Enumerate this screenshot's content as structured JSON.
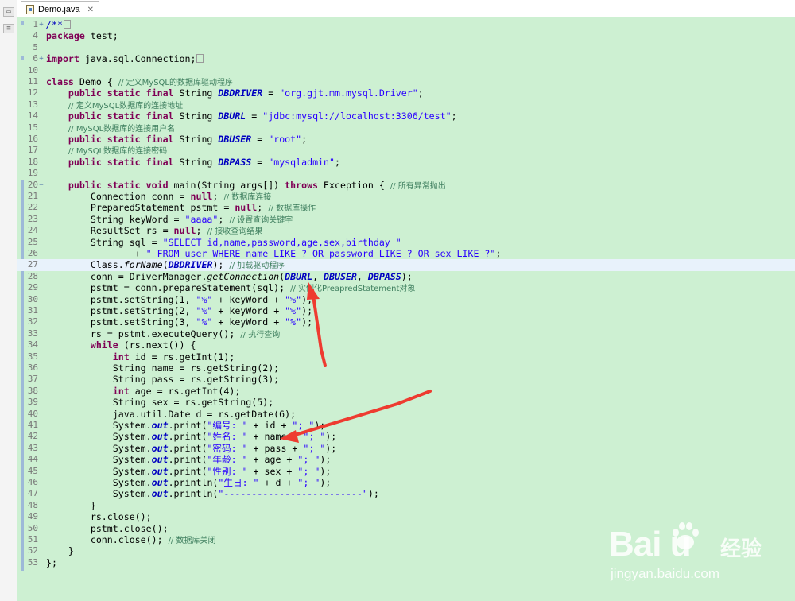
{
  "tab": {
    "title": "Demo.java",
    "close": "✕"
  },
  "watermark": {
    "brand": "Bai  u",
    "brand_cn": "经验",
    "url": "jingyan.baidu.com"
  },
  "code_lines": [
    {
      "n": "1",
      "fold": "+",
      "current": false,
      "tokens": [
        [
          "sfld",
          "/**"
        ],
        [
          "box",
          ""
        ]
      ]
    },
    {
      "n": "4",
      "tokens": [
        [
          "kw",
          "package"
        ],
        [
          "t",
          " test;"
        ]
      ]
    },
    {
      "n": "5",
      "tokens": []
    },
    {
      "n": "6",
      "fold": "+",
      "tokens": [
        [
          "kw",
          "import"
        ],
        [
          "t",
          " java.sql.Connection;"
        ],
        [
          "box",
          ""
        ]
      ]
    },
    {
      "n": "10",
      "tokens": []
    },
    {
      "n": "11",
      "tokens": [
        [
          "kw",
          "class"
        ],
        [
          "t",
          " Demo { "
        ],
        [
          "cm",
          "// 定义MySQL的数据库驱动程序"
        ]
      ]
    },
    {
      "n": "12",
      "tokens": [
        [
          "t",
          "    "
        ],
        [
          "kw",
          "public static final"
        ],
        [
          "t",
          " String "
        ],
        [
          "fld",
          "DBDRIVER"
        ],
        [
          "t",
          " = "
        ],
        [
          "str",
          "\"org.gjt.mm.mysql.Driver\""
        ],
        [
          "t",
          ";"
        ]
      ]
    },
    {
      "n": "13",
      "tokens": [
        [
          "t",
          "    "
        ],
        [
          "cm",
          "// 定义MySQL数据库的连接地址"
        ]
      ]
    },
    {
      "n": "14",
      "tokens": [
        [
          "t",
          "    "
        ],
        [
          "kw",
          "public static final"
        ],
        [
          "t",
          " String "
        ],
        [
          "fld",
          "DBURL"
        ],
        [
          "t",
          " = "
        ],
        [
          "str",
          "\"jdbc:mysql://localhost:3306/test\""
        ],
        [
          "t",
          ";"
        ]
      ]
    },
    {
      "n": "15",
      "tokens": [
        [
          "t",
          "    "
        ],
        [
          "cm",
          "// MySQL数据库的连接用户名"
        ]
      ]
    },
    {
      "n": "16",
      "tokens": [
        [
          "t",
          "    "
        ],
        [
          "kw",
          "public static final"
        ],
        [
          "t",
          " String "
        ],
        [
          "fld",
          "DBUSER"
        ],
        [
          "t",
          " = "
        ],
        [
          "str",
          "\"root\""
        ],
        [
          "t",
          ";"
        ]
      ]
    },
    {
      "n": "17",
      "tokens": [
        [
          "t",
          "    "
        ],
        [
          "cm",
          "// MySQL数据库的连接密码"
        ]
      ]
    },
    {
      "n": "18",
      "tokens": [
        [
          "t",
          "    "
        ],
        [
          "kw",
          "public static final"
        ],
        [
          "t",
          " String "
        ],
        [
          "fld",
          "DBPASS"
        ],
        [
          "t",
          " = "
        ],
        [
          "str",
          "\"mysqladmin\""
        ],
        [
          "t",
          ";"
        ]
      ]
    },
    {
      "n": "19",
      "tokens": []
    },
    {
      "n": "20",
      "fold": "−",
      "tokens": [
        [
          "t",
          "    "
        ],
        [
          "kw",
          "public static void"
        ],
        [
          "t",
          " main(String args[]) "
        ],
        [
          "kw",
          "throws"
        ],
        [
          "t",
          " Exception { "
        ],
        [
          "cm",
          "// 所有异常抛出"
        ]
      ]
    },
    {
      "n": "21",
      "tokens": [
        [
          "t",
          "        Connection conn = "
        ],
        [
          "kw",
          "null"
        ],
        [
          "t",
          "; "
        ],
        [
          "cm",
          "// 数据库连接"
        ]
      ]
    },
    {
      "n": "22",
      "tokens": [
        [
          "t",
          "        PreparedStatement pstmt = "
        ],
        [
          "kw",
          "null"
        ],
        [
          "t",
          "; "
        ],
        [
          "cm",
          "// 数据库操作"
        ]
      ]
    },
    {
      "n": "23",
      "tokens": [
        [
          "t",
          "        String keyWord = "
        ],
        [
          "str",
          "\"aaaa\""
        ],
        [
          "t",
          "; "
        ],
        [
          "cm",
          "// 设置查询关键字"
        ]
      ]
    },
    {
      "n": "24",
      "tokens": [
        [
          "t",
          "        ResultSet rs = "
        ],
        [
          "kw",
          "null"
        ],
        [
          "t",
          "; "
        ],
        [
          "cm",
          "// 接收查询结果"
        ]
      ]
    },
    {
      "n": "25",
      "tokens": [
        [
          "t",
          "        String sql = "
        ],
        [
          "str",
          "\"SELECT id,name,password,age,sex,birthday \""
        ]
      ]
    },
    {
      "n": "26",
      "tokens": [
        [
          "t",
          "                + "
        ],
        [
          "str",
          "\" FROM user WHERE name LIKE ? OR password LIKE ? OR sex LIKE ?\""
        ],
        [
          "t",
          ";"
        ]
      ]
    },
    {
      "n": "27",
      "current": true,
      "tokens": [
        [
          "t",
          "        Class."
        ],
        [
          "sm",
          "forName"
        ],
        [
          "t",
          "("
        ],
        [
          "fld",
          "DBDRIVER"
        ],
        [
          "t",
          "); "
        ],
        [
          "cm",
          "// 加载驱动程序"
        ],
        [
          "cursor",
          ""
        ]
      ]
    },
    {
      "n": "28",
      "tokens": [
        [
          "t",
          "        conn = DriverManager."
        ],
        [
          "sm",
          "getConnection"
        ],
        [
          "t",
          "("
        ],
        [
          "fld",
          "DBURL"
        ],
        [
          "t",
          ", "
        ],
        [
          "fld",
          "DBUSER"
        ],
        [
          "t",
          ", "
        ],
        [
          "fld",
          "DBPASS"
        ],
        [
          "t",
          ");"
        ]
      ]
    },
    {
      "n": "29",
      "tokens": [
        [
          "t",
          "        pstmt = conn.prepareStatement(sql); "
        ],
        [
          "cm",
          "// 实例化PreapredStatement对象"
        ]
      ]
    },
    {
      "n": "30",
      "tokens": [
        [
          "t",
          "        pstmt.setString(1, "
        ],
        [
          "str",
          "\"%\""
        ],
        [
          "t",
          " + keyWord + "
        ],
        [
          "str",
          "\"%\""
        ],
        [
          "t",
          ");"
        ]
      ]
    },
    {
      "n": "31",
      "tokens": [
        [
          "t",
          "        pstmt.setString(2, "
        ],
        [
          "str",
          "\"%\""
        ],
        [
          "t",
          " + keyWord + "
        ],
        [
          "str",
          "\"%\""
        ],
        [
          "t",
          ");"
        ]
      ]
    },
    {
      "n": "32",
      "tokens": [
        [
          "t",
          "        pstmt.setString(3, "
        ],
        [
          "str",
          "\"%\""
        ],
        [
          "t",
          " + keyWord + "
        ],
        [
          "str",
          "\"%\""
        ],
        [
          "t",
          ");"
        ]
      ]
    },
    {
      "n": "33",
      "tokens": [
        [
          "t",
          "        rs = pstmt.executeQuery(); "
        ],
        [
          "cm",
          "// 执行查询"
        ]
      ]
    },
    {
      "n": "34",
      "tokens": [
        [
          "t",
          "        "
        ],
        [
          "kw",
          "while"
        ],
        [
          "t",
          " (rs.next()) {"
        ]
      ]
    },
    {
      "n": "35",
      "tokens": [
        [
          "t",
          "            "
        ],
        [
          "kw",
          "int"
        ],
        [
          "t",
          " id = rs.getInt(1);"
        ]
      ]
    },
    {
      "n": "36",
      "tokens": [
        [
          "t",
          "            String name = rs.getString(2);"
        ]
      ]
    },
    {
      "n": "37",
      "tokens": [
        [
          "t",
          "            String pass = rs.getString(3);"
        ]
      ]
    },
    {
      "n": "38",
      "tokens": [
        [
          "t",
          "            "
        ],
        [
          "kw",
          "int"
        ],
        [
          "t",
          " age = rs.getInt(4);"
        ]
      ]
    },
    {
      "n": "39",
      "tokens": [
        [
          "t",
          "            String sex = rs.getString(5);"
        ]
      ]
    },
    {
      "n": "40",
      "tokens": [
        [
          "t",
          "            java.util.Date d = rs.getDate(6);"
        ]
      ]
    },
    {
      "n": "41",
      "tokens": [
        [
          "t",
          "            System."
        ],
        [
          "fld",
          "out"
        ],
        [
          "t",
          ".print("
        ],
        [
          "str",
          "\"编号: \""
        ],
        [
          "t",
          " + id + "
        ],
        [
          "str",
          "\"; \""
        ],
        [
          "t",
          ");"
        ]
      ]
    },
    {
      "n": "42",
      "tokens": [
        [
          "t",
          "            System."
        ],
        [
          "fld",
          "out"
        ],
        [
          "t",
          ".print("
        ],
        [
          "str",
          "\"姓名: \""
        ],
        [
          "t",
          " + name + "
        ],
        [
          "str",
          "\"; \""
        ],
        [
          "t",
          ");"
        ]
      ]
    },
    {
      "n": "43",
      "tokens": [
        [
          "t",
          "            System."
        ],
        [
          "fld",
          "out"
        ],
        [
          "t",
          ".print("
        ],
        [
          "str",
          "\"密码: \""
        ],
        [
          "t",
          " + pass + "
        ],
        [
          "str",
          "\"; \""
        ],
        [
          "t",
          ");"
        ]
      ]
    },
    {
      "n": "44",
      "tokens": [
        [
          "t",
          "            System."
        ],
        [
          "fld",
          "out"
        ],
        [
          "t",
          ".print("
        ],
        [
          "str",
          "\"年龄: \""
        ],
        [
          "t",
          " + age + "
        ],
        [
          "str",
          "\"; \""
        ],
        [
          "t",
          ");"
        ]
      ]
    },
    {
      "n": "45",
      "tokens": [
        [
          "t",
          "            System."
        ],
        [
          "fld",
          "out"
        ],
        [
          "t",
          ".print("
        ],
        [
          "str",
          "\"性别: \""
        ],
        [
          "t",
          " + sex + "
        ],
        [
          "str",
          "\"; \""
        ],
        [
          "t",
          ");"
        ]
      ]
    },
    {
      "n": "46",
      "tokens": [
        [
          "t",
          "            System."
        ],
        [
          "fld",
          "out"
        ],
        [
          "t",
          ".println("
        ],
        [
          "str",
          "\"生日: \""
        ],
        [
          "t",
          " + d + "
        ],
        [
          "str",
          "\"; \""
        ],
        [
          "t",
          ");"
        ]
      ]
    },
    {
      "n": "47",
      "tokens": [
        [
          "t",
          "            System."
        ],
        [
          "fld",
          "out"
        ],
        [
          "t",
          ".println("
        ],
        [
          "str",
          "\"-------------------------\""
        ],
        [
          "t",
          ");"
        ]
      ]
    },
    {
      "n": "48",
      "tokens": [
        [
          "t",
          "        }"
        ]
      ]
    },
    {
      "n": "49",
      "tokens": [
        [
          "t",
          "        rs.close();"
        ]
      ]
    },
    {
      "n": "50",
      "tokens": [
        [
          "t",
          "        pstmt.close();"
        ]
      ]
    },
    {
      "n": "51",
      "tokens": [
        [
          "t",
          "        conn.close(); "
        ],
        [
          "cm",
          "// 数据库关闭"
        ]
      ]
    },
    {
      "n": "52",
      "tokens": [
        [
          "t",
          "    }"
        ]
      ]
    },
    {
      "n": "53",
      "tokens": [
        [
          "t",
          "};"
        ]
      ]
    }
  ],
  "colors": {
    "editor_bg": "#cdf0d2",
    "keyword": "#7f0055",
    "string": "#2a00ff",
    "comment": "#3f7f5f",
    "field": "#0000c0",
    "arrow": "#ee3b30"
  }
}
